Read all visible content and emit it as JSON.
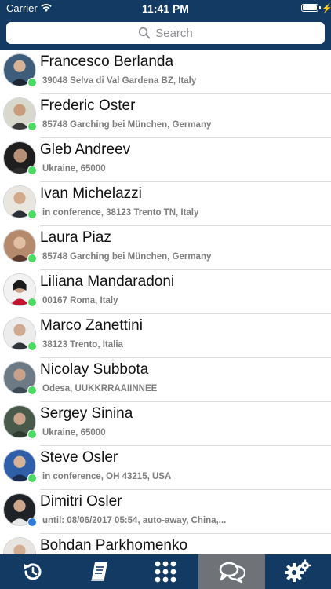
{
  "status_bar": {
    "carrier": "Carrier",
    "time": "11:41 PM"
  },
  "search": {
    "placeholder": "Search"
  },
  "contacts": [
    {
      "name": "Francesco Berlanda",
      "detail": "39048 Selva di Val Gardena BZ, Italy",
      "presence": "online"
    },
    {
      "name": "Frederic Oster",
      "detail": "85748 Garching bei München, Germany",
      "presence": "online"
    },
    {
      "name": "Gleb Andreev",
      "detail": "Ukraine, 65000",
      "presence": "online"
    },
    {
      "name": "Ivan Michelazzi",
      "detail": "in conference,  38123 Trento TN, Italy",
      "presence": "online"
    },
    {
      "name": "Laura Piaz",
      "detail": "85748 Garching bei München, Germany",
      "presence": "online"
    },
    {
      "name": "Liliana Mandaradoni",
      "detail": "00167 Roma, Italy",
      "presence": "online"
    },
    {
      "name": "Marco Zanettini",
      "detail": "38123 Trento, Italia",
      "presence": "online"
    },
    {
      "name": "Nicolay Subbota",
      "detail": "Odesa, UUKKRRAAIINNEE",
      "presence": "online"
    },
    {
      "name": "Sergey Sinina",
      "detail": "Ukraine, 65000",
      "presence": "online"
    },
    {
      "name": "Steve Osler",
      "detail": "in conference,  OH 43215, USA",
      "presence": "online"
    },
    {
      "name": "Dimitri Osler",
      "detail": "until: 08/06/2017 05:54,  auto-away,  China,...",
      "presence": "away"
    },
    {
      "name": "Bohdan Parkhomenko",
      "detail": "",
      "presence": "online"
    }
  ],
  "tabbar": {
    "tabs": [
      {
        "id": "history",
        "icon": "history-icon",
        "active": false
      },
      {
        "id": "contacts",
        "icon": "address-book-icon",
        "active": false
      },
      {
        "id": "keypad",
        "icon": "keypad-icon",
        "active": false
      },
      {
        "id": "chats",
        "icon": "chat-bubbles-icon",
        "active": true
      },
      {
        "id": "settings",
        "icon": "gears-icon",
        "active": false
      }
    ]
  },
  "colors": {
    "header": "#133a63",
    "online": "#4cd964",
    "away": "#2f7bdc",
    "active_tab": "#6f7378"
  }
}
